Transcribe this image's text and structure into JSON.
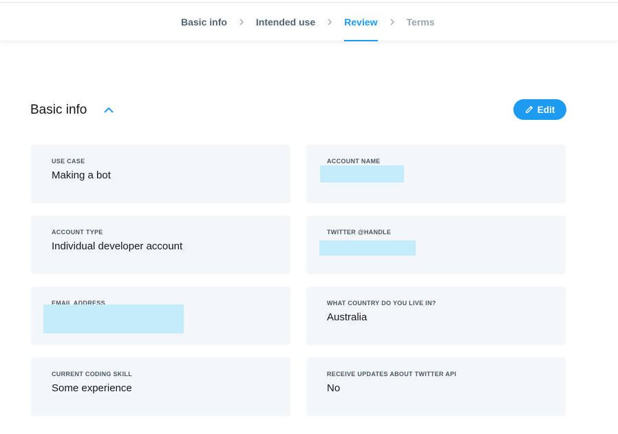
{
  "stepper": {
    "steps": [
      {
        "label": "Basic info",
        "state": "done"
      },
      {
        "label": "Intended use",
        "state": "done"
      },
      {
        "label": "Review",
        "state": "active"
      },
      {
        "label": "Terms",
        "state": "upcoming"
      }
    ],
    "separator_icon": "chevron-right-icon"
  },
  "section": {
    "title": "Basic info",
    "collapse_icon": "chevron-up-icon",
    "edit_label": "Edit",
    "edit_icon": "pencil-icon"
  },
  "fields": {
    "use_case": {
      "label": "USE CASE",
      "value": "Making a bot"
    },
    "account_name": {
      "label": "ACCOUNT NAME",
      "value": ""
    },
    "account_type": {
      "label": "ACCOUNT TYPE",
      "value": "Individual developer account"
    },
    "twitter_handle": {
      "label": "TWITTER @HANDLE",
      "value": ""
    },
    "email_address": {
      "label": "EMAIL ADDRESS",
      "value": ""
    },
    "country": {
      "label": "WHAT COUNTRY DO YOU LIVE IN?",
      "value": "Australia"
    },
    "coding_skill": {
      "label": "CURRENT CODING SKILL",
      "value": "Some experience"
    },
    "receive_updates": {
      "label": "RECEIVE UPDATES ABOUT TWITTER API",
      "value": "No"
    }
  },
  "colors": {
    "accent": "#1d9bf0",
    "card_background": "#f4f7f9",
    "redaction": "#c4ecfb"
  }
}
